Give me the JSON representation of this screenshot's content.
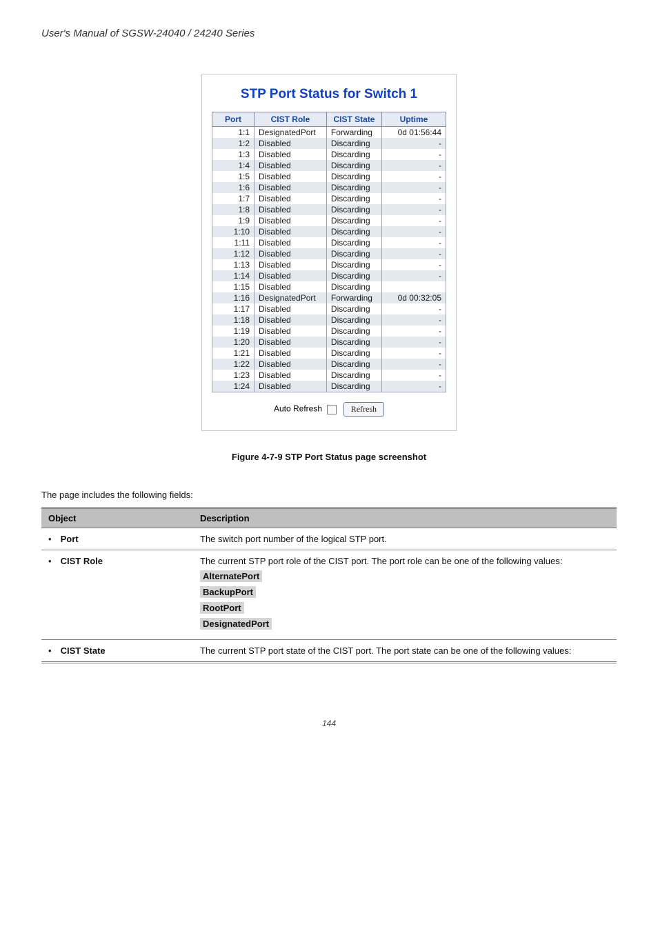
{
  "manual_title": "User's Manual of SGSW-24040 / 24240 Series",
  "screenshot": {
    "title": "STP Port Status for Switch 1",
    "headers": [
      "Port",
      "CIST Role",
      "CIST State",
      "Uptime"
    ],
    "rows": [
      {
        "port": "1:1",
        "role": "DesignatedPort",
        "state": "Forwarding",
        "uptime": "0d 01:56:44"
      },
      {
        "port": "1:2",
        "role": "Disabled",
        "state": "Discarding",
        "uptime": "-"
      },
      {
        "port": "1:3",
        "role": "Disabled",
        "state": "Discarding",
        "uptime": "-"
      },
      {
        "port": "1:4",
        "role": "Disabled",
        "state": "Discarding",
        "uptime": "-"
      },
      {
        "port": "1:5",
        "role": "Disabled",
        "state": "Discarding",
        "uptime": "-"
      },
      {
        "port": "1:6",
        "role": "Disabled",
        "state": "Discarding",
        "uptime": "-"
      },
      {
        "port": "1:7",
        "role": "Disabled",
        "state": "Discarding",
        "uptime": "-"
      },
      {
        "port": "1:8",
        "role": "Disabled",
        "state": "Discarding",
        "uptime": "-"
      },
      {
        "port": "1:9",
        "role": "Disabled",
        "state": "Discarding",
        "uptime": "-"
      },
      {
        "port": "1:10",
        "role": "Disabled",
        "state": "Discarding",
        "uptime": "-"
      },
      {
        "port": "1:11",
        "role": "Disabled",
        "state": "Discarding",
        "uptime": "-"
      },
      {
        "port": "1:12",
        "role": "Disabled",
        "state": "Discarding",
        "uptime": "-"
      },
      {
        "port": "1:13",
        "role": "Disabled",
        "state": "Discarding",
        "uptime": "-"
      },
      {
        "port": "1:14",
        "role": "Disabled",
        "state": "Discarding",
        "uptime": "-"
      },
      {
        "port": "1:15",
        "role": "Disabled",
        "state": "Discarding",
        "uptime": ""
      },
      {
        "port": "1:16",
        "role": "DesignatedPort",
        "state": "Forwarding",
        "uptime": "0d 00:32:05"
      },
      {
        "port": "1:17",
        "role": "Disabled",
        "state": "Discarding",
        "uptime": "-"
      },
      {
        "port": "1:18",
        "role": "Disabled",
        "state": "Discarding",
        "uptime": "-"
      },
      {
        "port": "1:19",
        "role": "Disabled",
        "state": "Discarding",
        "uptime": "-"
      },
      {
        "port": "1:20",
        "role": "Disabled",
        "state": "Discarding",
        "uptime": "-"
      },
      {
        "port": "1:21",
        "role": "Disabled",
        "state": "Discarding",
        "uptime": "-"
      },
      {
        "port": "1:22",
        "role": "Disabled",
        "state": "Discarding",
        "uptime": "-"
      },
      {
        "port": "1:23",
        "role": "Disabled",
        "state": "Discarding",
        "uptime": "-"
      },
      {
        "port": "1:24",
        "role": "Disabled",
        "state": "Discarding",
        "uptime": "-"
      }
    ],
    "auto_refresh_label": "Auto Refresh",
    "refresh_button": "Refresh"
  },
  "figure_caption": "Figure 4-7-9 STP Port Status page screenshot",
  "intro_text": "The page includes the following fields:",
  "desc_headers": {
    "object": "Object",
    "description": "Description"
  },
  "desc_rows": [
    {
      "term": "Port",
      "desc": "The switch port number of the logical STP port."
    },
    {
      "term": "CIST Role",
      "desc_lead": "The current STP port role of the CIST port. The port role can be one of the following values:",
      "roles": [
        "AlternatePort",
        "BackupPort",
        "RootPort",
        "DesignatedPort"
      ]
    },
    {
      "term": "CIST State",
      "desc_lead": "The current STP port state of the CIST port. The port state can be one of the following values:"
    }
  ],
  "footer": "144"
}
